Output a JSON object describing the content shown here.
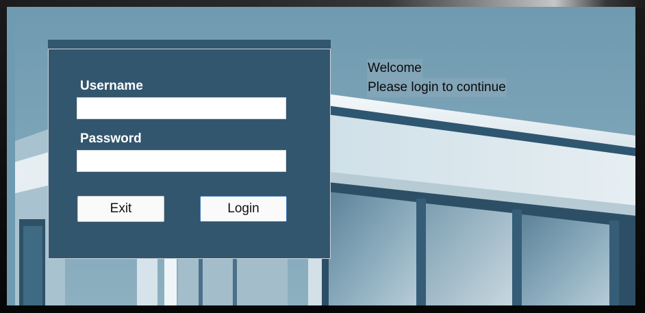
{
  "welcome": {
    "line1": "Welcome",
    "line2": "Please login to continue"
  },
  "form": {
    "username_label": "Username",
    "username_value": "",
    "password_label": "Password",
    "password_value": "",
    "exit_label": "Exit",
    "login_label": "Login"
  },
  "colors": {
    "panel": "#33566f",
    "sky": "#7aa3b5",
    "button_focus_border": "#3d7bbb"
  }
}
